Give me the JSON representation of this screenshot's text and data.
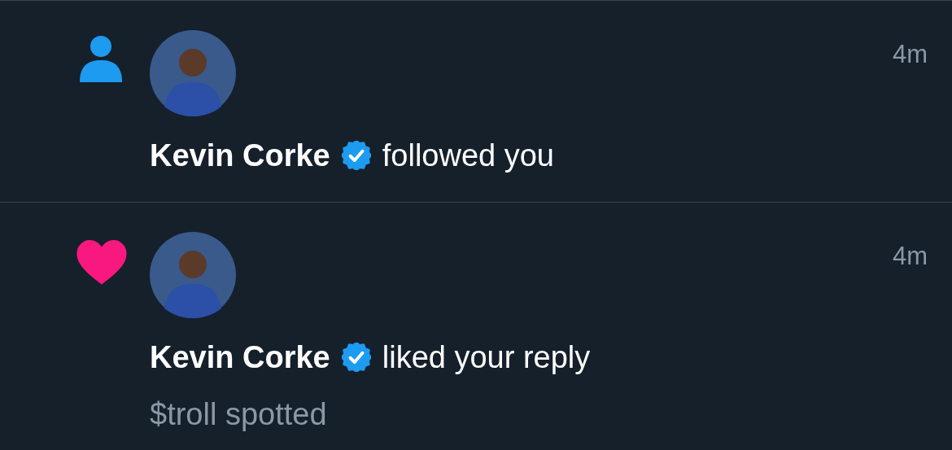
{
  "notifications": [
    {
      "kind": "follow",
      "name": "Kevin Corke",
      "verified": true,
      "action": "followed you",
      "time": "4m"
    },
    {
      "kind": "like",
      "name": "Kevin Corke",
      "verified": true,
      "action": "liked your reply",
      "time": "4m",
      "snippet": "$troll spotted"
    }
  ]
}
